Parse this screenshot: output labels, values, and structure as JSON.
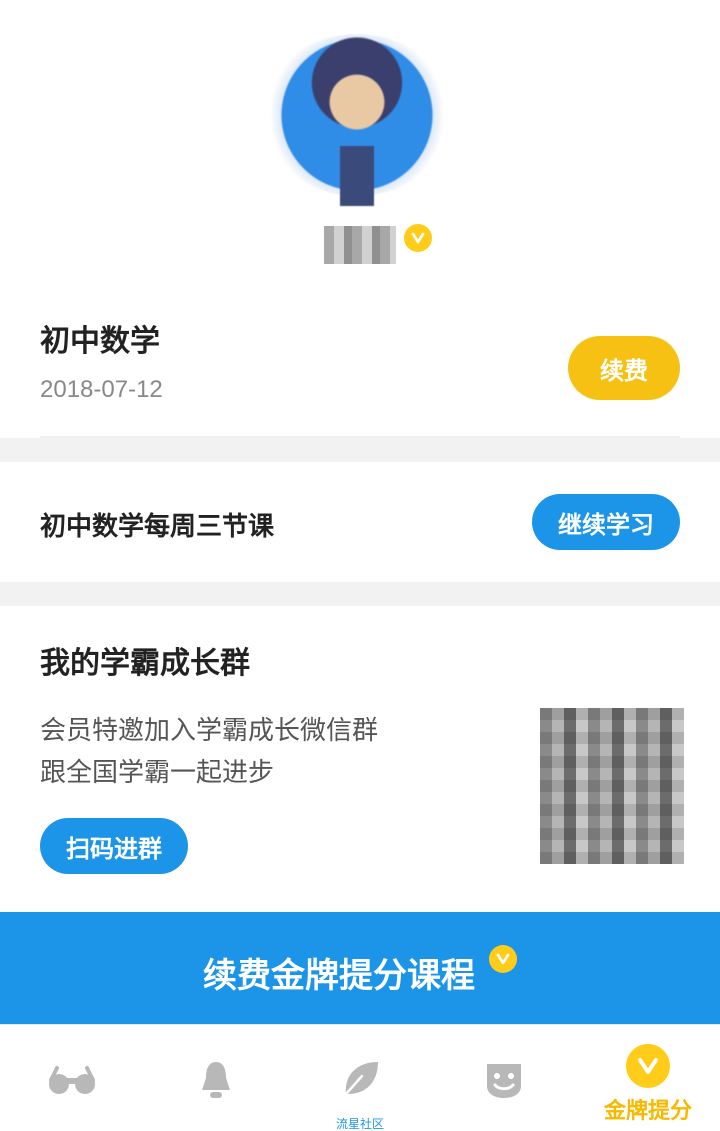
{
  "course": {
    "title": "初中数学",
    "date": "2018-07-12",
    "renew_label": "续费"
  },
  "lesson": {
    "title": "初中数学每周三节课",
    "continue_label": "继续学习"
  },
  "group": {
    "title": "我的学霸成长群",
    "desc_line1": "会员特邀加入学霸成长微信群",
    "desc_line2": "跟全国学霸一起进步",
    "scan_label": "扫码进群"
  },
  "promo": {
    "label": "续费金牌提分课程"
  },
  "tabbar": {
    "tabs": [
      {
        "icon": "glasses-icon",
        "label": ""
      },
      {
        "icon": "bell-icon",
        "label": ""
      },
      {
        "icon": "leaf-icon",
        "label": "流星社区"
      },
      {
        "icon": "smiley-icon",
        "label": ""
      },
      {
        "icon": "gold-v-icon",
        "label": "金牌提分"
      }
    ],
    "active_index": 4
  },
  "colors": {
    "primary_blue": "#1c95e8",
    "gold": "#ffcc1a",
    "renew_yellow": "#f6c112",
    "icon_gray": "#b8b8b8"
  }
}
